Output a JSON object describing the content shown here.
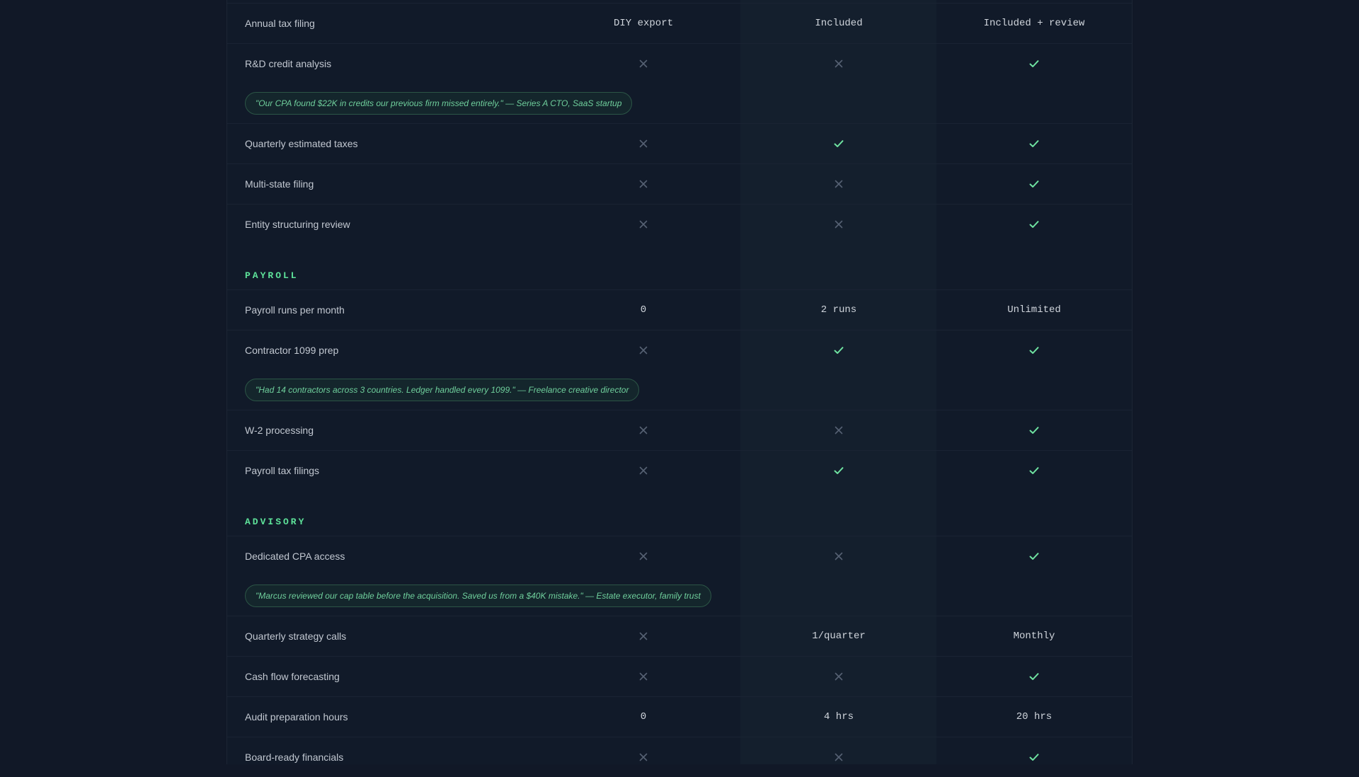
{
  "colors": {
    "check": "#6fe3a1",
    "cross": "#566173",
    "accent": "#5ee39a"
  },
  "rows": [
    {
      "type": "row",
      "label": "Annual tax filing",
      "c1": "DIY export",
      "c2": "Included",
      "c3": "Included + review"
    },
    {
      "type": "row",
      "label": "R&D credit analysis",
      "c1": "no",
      "c2": "no",
      "c3": "yes"
    },
    {
      "type": "quote",
      "text": "\"Our CPA found $22K in credits our previous firm missed entirely.\" — Series A CTO, SaaS startup"
    },
    {
      "type": "row",
      "label": "Quarterly estimated taxes",
      "c1": "no",
      "c2": "yes",
      "c3": "yes"
    },
    {
      "type": "row",
      "label": "Multi-state filing",
      "c1": "no",
      "c2": "no",
      "c3": "yes"
    },
    {
      "type": "row",
      "label": "Entity structuring review",
      "c1": "no",
      "c2": "no",
      "c3": "yes"
    },
    {
      "type": "section",
      "label": "PAYROLL"
    },
    {
      "type": "row",
      "label": "Payroll runs per month",
      "c1": "0",
      "c2": "2 runs",
      "c3": "Unlimited"
    },
    {
      "type": "row",
      "label": "Contractor 1099 prep",
      "c1": "no",
      "c2": "yes",
      "c3": "yes"
    },
    {
      "type": "quote",
      "text": "\"Had 14 contractors across 3 countries. Ledger handled every 1099.\" — Freelance creative director"
    },
    {
      "type": "row",
      "label": "W-2 processing",
      "c1": "no",
      "c2": "no",
      "c3": "yes"
    },
    {
      "type": "row",
      "label": "Payroll tax filings",
      "c1": "no",
      "c2": "yes",
      "c3": "yes"
    },
    {
      "type": "section",
      "label": "ADVISORY"
    },
    {
      "type": "row",
      "label": "Dedicated CPA access",
      "c1": "no",
      "c2": "no",
      "c3": "yes"
    },
    {
      "type": "quote",
      "text": "\"Marcus reviewed our cap table before the acquisition. Saved us from a $40K mistake.\" — Estate executor, family trust"
    },
    {
      "type": "row",
      "label": "Quarterly strategy calls",
      "c1": "no",
      "c2": "1/quarter",
      "c3": "Monthly"
    },
    {
      "type": "row",
      "label": "Cash flow forecasting",
      "c1": "no",
      "c2": "no",
      "c3": "yes"
    },
    {
      "type": "row",
      "label": "Audit preparation hours",
      "c1": "0",
      "c2": "4 hrs",
      "c3": "20 hrs"
    },
    {
      "type": "row",
      "label": "Board-ready financials",
      "c1": "no",
      "c2": "no",
      "c3": "yes"
    }
  ]
}
